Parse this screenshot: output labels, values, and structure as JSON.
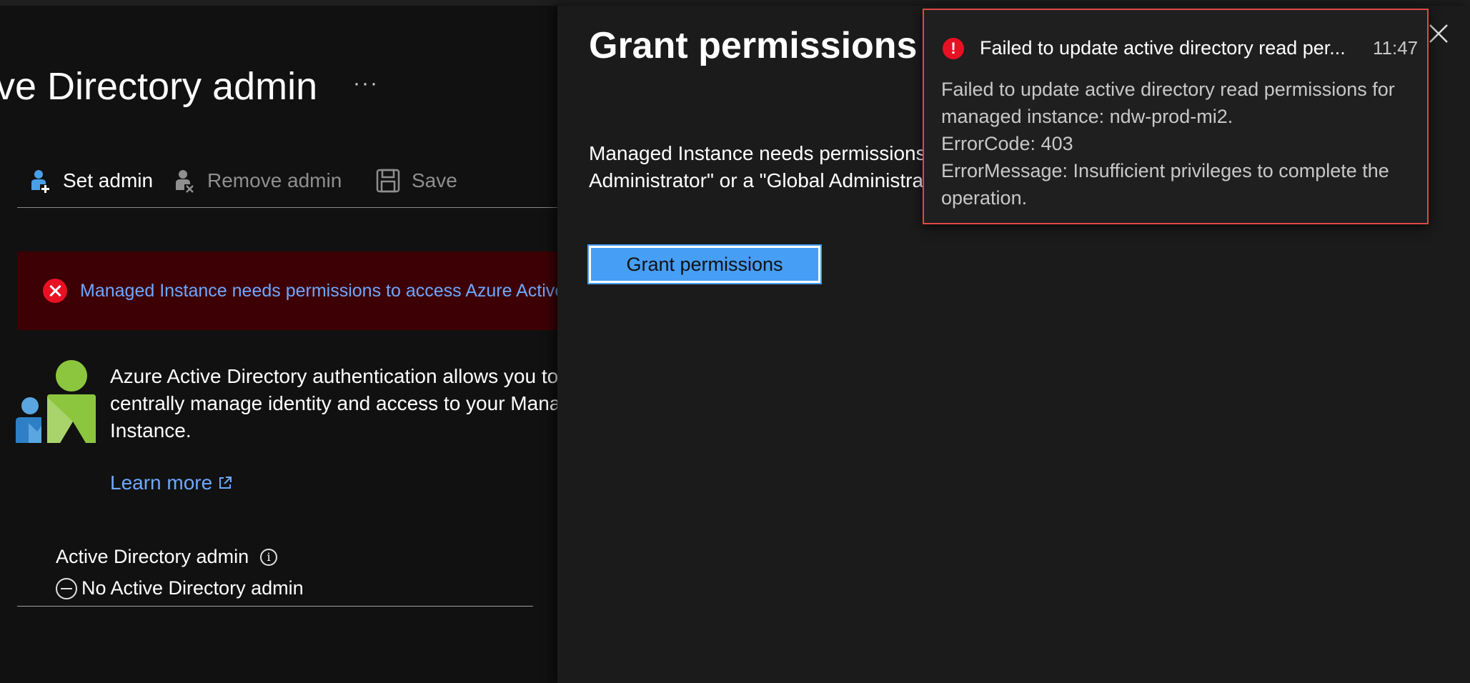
{
  "left": {
    "title": "ve Directory admin",
    "more_label": "···",
    "toolbar": {
      "set_admin": "Set admin",
      "remove_admin": "Remove admin",
      "save": "Save"
    },
    "banner_text": "Managed Instance needs permissions to access Azure Active Directory",
    "description": "Azure Active Directory authentication allows you to centrally manage identity and access to your Managed Instance.",
    "learn_more": "Learn more",
    "admin_label": "Active Directory admin",
    "info_glyph": "i",
    "admin_value": "No Active Directory admin"
  },
  "panel": {
    "title": "Grant permissions",
    "description": "Managed Instance needs permissions to access Azure Active Directory. Only a \"Company Administrator\" or a \"Global Administrator\" can grant permissions to the Managed Instance.",
    "grant_button": "Grant permissions"
  },
  "toast": {
    "icon_glyph": "!",
    "title": "Failed to update active directory read per...",
    "time": "11:47",
    "body_lines": [
      "Failed to update active directory read permissions for managed instance: ndw-prod-mi2.",
      "ErrorCode: 403",
      "ErrorMessage: Insufficient privileges to complete the operation."
    ]
  },
  "colors": {
    "accent_blue": "#479ef5",
    "link_blue": "#6ea8ff",
    "error_red": "#e81123",
    "banner_bg": "#3d0005"
  }
}
